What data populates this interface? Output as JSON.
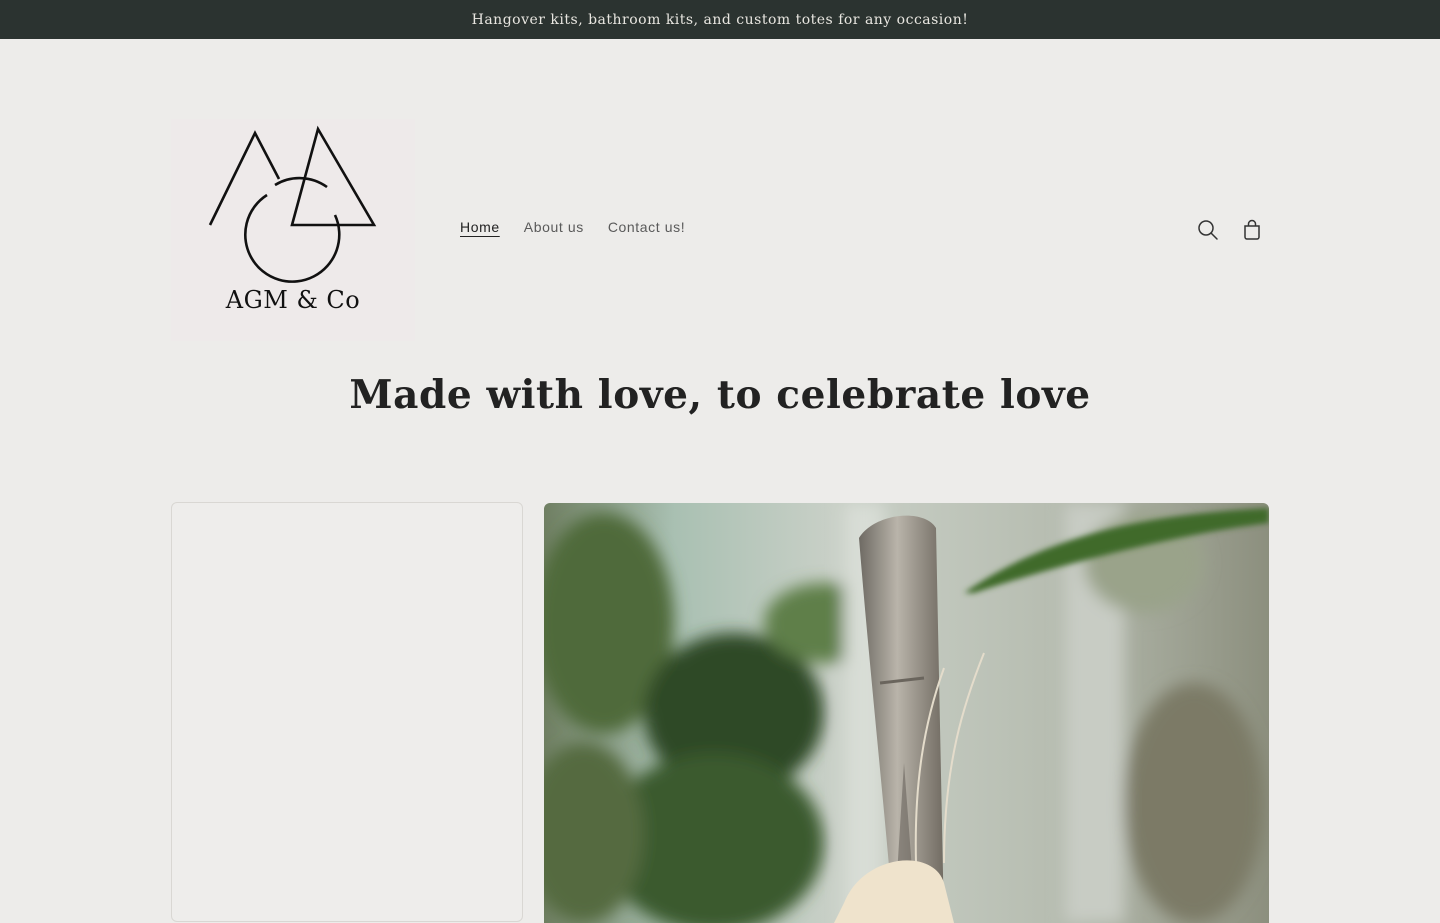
{
  "announcement": {
    "text": "Hangover kits, bathroom kits, and custom totes for any occasion!"
  },
  "brand": {
    "name": "AGM & Co"
  },
  "nav": {
    "items": [
      {
        "label": "Home",
        "active": true
      },
      {
        "label": "About us",
        "active": false
      },
      {
        "label": "Contact us!",
        "active": false
      }
    ]
  },
  "header_icons": {
    "search": "search-icon",
    "cart": "cart-icon"
  },
  "hero": {
    "title": "Made with love, to celebrate love"
  },
  "colors": {
    "announcement_bg": "#2b3330",
    "page_bg": "#edecea",
    "text": "#222222"
  }
}
